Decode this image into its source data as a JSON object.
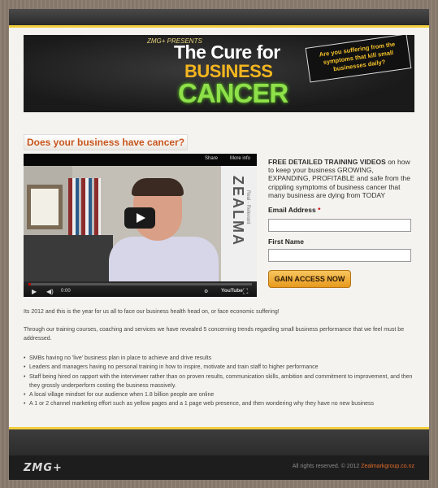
{
  "banner": {
    "presents": "ZMG+ PRESENTS",
    "title_line1": "The Cure for",
    "title_line2": "BUSINESS",
    "title_line3": "CANCER",
    "callout": "Are you suffering from the symptoms that kill small businesses daily?"
  },
  "main": {
    "heading": "Does your business have cancer?",
    "video": {
      "share_label": "Share",
      "more_label": "More info",
      "banner_text": "ZEALMA",
      "banner_sub": "Real · Relevant",
      "time": "0:00",
      "progress": 0.0,
      "youtube_label": "YouTube"
    },
    "intro": "Its 2012 and this is the year for us all to face our business health head on, or face economic suffering!",
    "paragraph": "Through our training courses, coaching and services we have revealed 5 concerning trends regarding small business performance that we feel must be addressed.",
    "bullets": [
      "SMBs having no 'live' business plan in place to achieve and drive results",
      "Leaders and managers having no personal training in how to inspire, motivate and train staff to higher performance",
      "Staff being hired on rapport with the interviewer rather than on proven results, communication skills, ambition and commitment to improvement, and then they grossly underperform costing the business massively.",
      "A local village mindset for our audience when 1.8 billion people are online",
      "A 1 or 2 channel marketing effort such as yellow pages and a 1 page web presence, and then wondering why they have no new business"
    ]
  },
  "form": {
    "intro_bold": "FREE DETAILED TRAINING VIDEOS",
    "intro_rest": " on how to keep your business GROWING, EXPANDING, PROFITABLE and safe from the crippling symptoms of business cancer that many business are dying from TODAY",
    "email_label": "Email Address",
    "required_mark": "*",
    "email_value": "",
    "firstname_label": "First Name",
    "firstname_value": "",
    "submit_label": "GAIN ACCESS NOW"
  },
  "footer": {
    "logo": "ZMG+",
    "copyright": "All rights reserved. © 2012 ",
    "site": "Zealmarkgroup.co.nz"
  }
}
